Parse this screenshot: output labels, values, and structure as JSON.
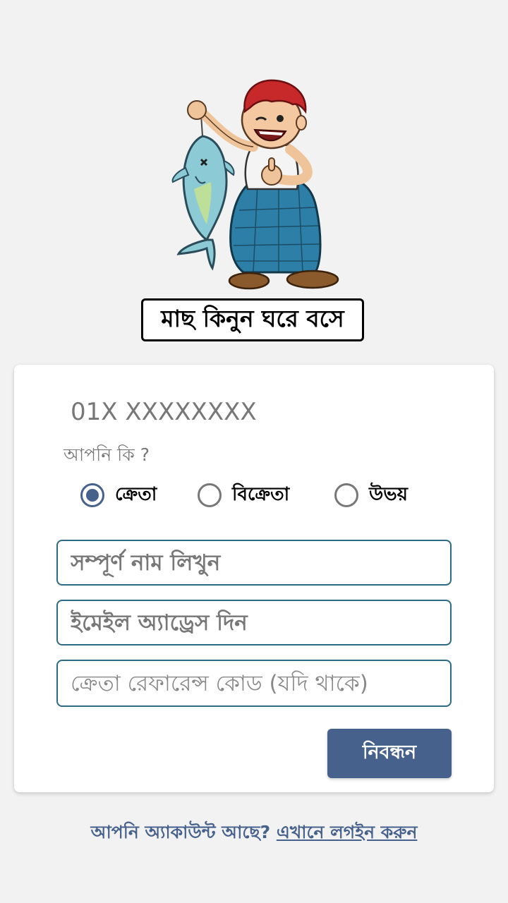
{
  "header": {
    "mascot_icon": "fisherman-holding-fish-illustration",
    "tagline": "মাছ কিনুন ঘরে বসে"
  },
  "form": {
    "phone_placeholder": "01X XXXXXXXX",
    "question": "আপনি কি ?",
    "role_options": [
      {
        "label": "ক্রেতা",
        "selected": true
      },
      {
        "label": "বিক্রেতা",
        "selected": false
      },
      {
        "label": "উভয়",
        "selected": false
      }
    ],
    "name_placeholder": "সম্পূর্ণ নাম লিখুন",
    "email_placeholder": "ইমেইল অ্যাড্রেস দিন",
    "referral_placeholder": "ক্রেতা রেফারেন্স কোড (যদি থাকে)",
    "submit_label": "নিবন্ধন"
  },
  "footer": {
    "prompt": "আপনি অ্যাকাউন্ট আছে?",
    "login_link": "এখানে লগইন করুন"
  },
  "colors": {
    "accent": "#46618c",
    "field_border": "#2c6b84",
    "background": "#f2f2f2"
  }
}
